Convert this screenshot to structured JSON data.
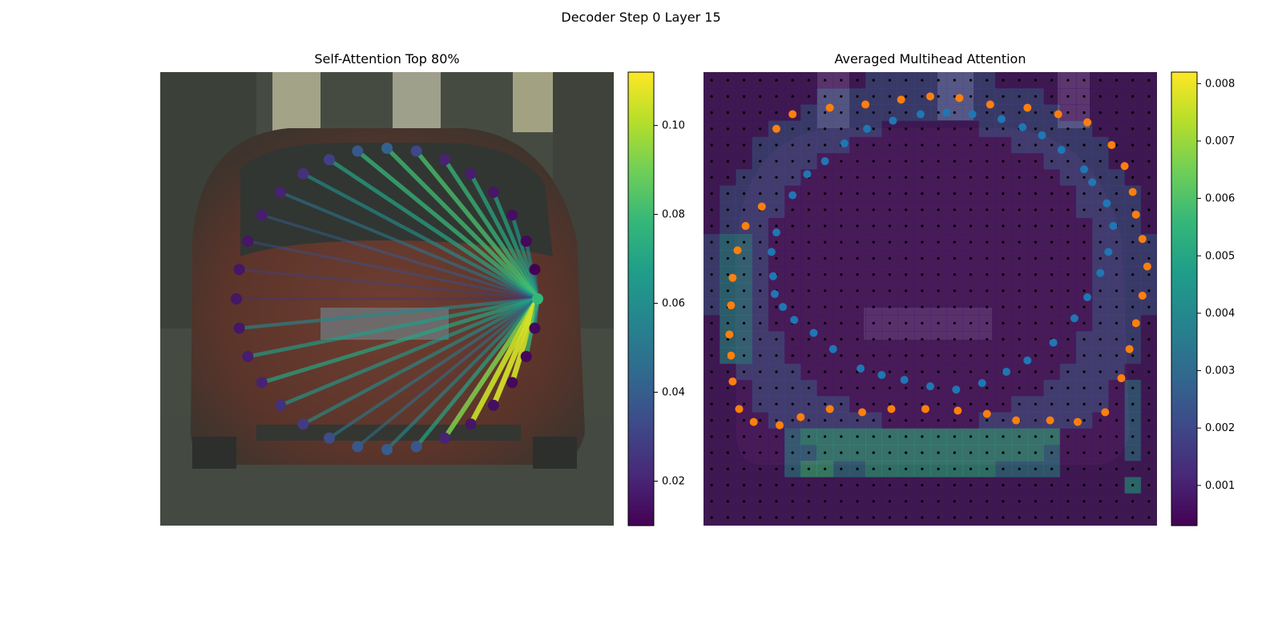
{
  "figure": {
    "suptitle": "Decoder Step 0 Layer 15"
  },
  "chart_data": [
    {
      "type": "network",
      "title": "Self-Attention Top 80%",
      "colormap": "viridis",
      "query_node_index": 0,
      "nodes": [
        {
          "id": 0,
          "x": 1.0,
          "y": 0.0,
          "weight": 0.078
        },
        {
          "id": 1,
          "x": 0.981,
          "y": 0.195,
          "weight": 0.01
        },
        {
          "id": 2,
          "x": 0.924,
          "y": 0.383,
          "weight": 0.012
        },
        {
          "id": 3,
          "x": 0.831,
          "y": 0.556,
          "weight": 0.014
        },
        {
          "id": 4,
          "x": 0.707,
          "y": 0.707,
          "weight": 0.016
        },
        {
          "id": 5,
          "x": 0.556,
          "y": 0.831,
          "weight": 0.018
        },
        {
          "id": 6,
          "x": 0.383,
          "y": 0.924,
          "weight": 0.02
        },
        {
          "id": 7,
          "x": 0.195,
          "y": 0.981,
          "weight": 0.032
        },
        {
          "id": 8,
          "x": 0.0,
          "y": 1.0,
          "weight": 0.042
        },
        {
          "id": 9,
          "x": -0.195,
          "y": 0.981,
          "weight": 0.038
        },
        {
          "id": 10,
          "x": -0.383,
          "y": 0.924,
          "weight": 0.03
        },
        {
          "id": 11,
          "x": -0.556,
          "y": 0.831,
          "weight": 0.024
        },
        {
          "id": 12,
          "x": -0.707,
          "y": 0.707,
          "weight": 0.02
        },
        {
          "id": 13,
          "x": -0.831,
          "y": 0.556,
          "weight": 0.018
        },
        {
          "id": 14,
          "x": -0.924,
          "y": 0.383,
          "weight": 0.016
        },
        {
          "id": 15,
          "x": -0.981,
          "y": 0.195,
          "weight": 0.016
        },
        {
          "id": 16,
          "x": -1.0,
          "y": 0.0,
          "weight": 0.016
        },
        {
          "id": 17,
          "x": -0.981,
          "y": -0.195,
          "weight": 0.016
        },
        {
          "id": 18,
          "x": -0.924,
          "y": -0.383,
          "weight": 0.018
        },
        {
          "id": 19,
          "x": -0.831,
          "y": -0.556,
          "weight": 0.02
        },
        {
          "id": 20,
          "x": -0.707,
          "y": -0.707,
          "weight": 0.024
        },
        {
          "id": 21,
          "x": -0.556,
          "y": -0.831,
          "weight": 0.028
        },
        {
          "id": 22,
          "x": -0.383,
          "y": -0.924,
          "weight": 0.034
        },
        {
          "id": 23,
          "x": -0.195,
          "y": -0.981,
          "weight": 0.038
        },
        {
          "id": 24,
          "x": 0.0,
          "y": -1.0,
          "weight": 0.04
        },
        {
          "id": 25,
          "x": 0.195,
          "y": -0.981,
          "weight": 0.038
        },
        {
          "id": 26,
          "x": 0.383,
          "y": -0.924,
          "weight": 0.02
        },
        {
          "id": 27,
          "x": 0.556,
          "y": -0.831,
          "weight": 0.016
        },
        {
          "id": 28,
          "x": 0.707,
          "y": -0.707,
          "weight": 0.014
        },
        {
          "id": 29,
          "x": 0.831,
          "y": -0.556,
          "weight": 0.012
        },
        {
          "id": 30,
          "x": 0.924,
          "y": -0.383,
          "weight": 0.012
        },
        {
          "id": 31,
          "x": 0.981,
          "y": -0.195,
          "weight": 0.012
        }
      ],
      "edges": [
        {
          "to": 1,
          "weight": 0.045
        },
        {
          "to": 2,
          "weight": 0.06
        },
        {
          "to": 3,
          "weight": 0.065
        },
        {
          "to": 4,
          "weight": 0.07
        },
        {
          "to": 5,
          "weight": 0.072
        },
        {
          "to": 6,
          "weight": 0.078
        },
        {
          "to": 7,
          "weight": 0.082
        },
        {
          "to": 8,
          "weight": 0.08
        },
        {
          "to": 9,
          "weight": 0.078
        },
        {
          "to": 10,
          "weight": 0.07
        },
        {
          "to": 11,
          "weight": 0.06
        },
        {
          "to": 12,
          "weight": 0.05
        },
        {
          "to": 13,
          "weight": 0.04
        },
        {
          "to": 14,
          "weight": 0.035
        },
        {
          "to": 15,
          "weight": 0.03
        },
        {
          "to": 16,
          "weight": 0.025
        },
        {
          "to": 17,
          "weight": 0.058
        },
        {
          "to": 18,
          "weight": 0.066
        },
        {
          "to": 19,
          "weight": 0.07
        },
        {
          "to": 20,
          "weight": 0.064
        },
        {
          "to": 21,
          "weight": 0.06
        },
        {
          "to": 22,
          "weight": 0.052
        },
        {
          "to": 23,
          "weight": 0.048
        },
        {
          "to": 24,
          "weight": 0.058
        },
        {
          "to": 25,
          "weight": 0.07
        },
        {
          "to": 26,
          "weight": 0.092
        },
        {
          "to": 27,
          "weight": 0.104
        },
        {
          "to": 28,
          "weight": 0.106
        },
        {
          "to": 29,
          "weight": 0.105
        },
        {
          "to": 30,
          "weight": 0.078
        },
        {
          "to": 31,
          "weight": 0.062
        }
      ],
      "colorbar": {
        "min": 0.01,
        "max": 0.112,
        "ticks": [
          0.02,
          0.04,
          0.06,
          0.08,
          0.1
        ],
        "tick_labels": [
          "0.02",
          "0.04",
          "0.06",
          "0.08",
          "0.10"
        ]
      }
    },
    {
      "type": "heatmap",
      "title": "Averaged Multihead Attention",
      "colormap": "viridis",
      "grid_size": [
        28,
        28
      ],
      "orange_points_xy_grid": [
        [
          4.5,
          3.5
        ],
        [
          5.5,
          2.6
        ],
        [
          7.8,
          2.2
        ],
        [
          10,
          2
        ],
        [
          12.2,
          1.7
        ],
        [
          14.0,
          1.5
        ],
        [
          15.8,
          1.6
        ],
        [
          17.7,
          2.0
        ],
        [
          20.0,
          2.2
        ],
        [
          21.9,
          2.6
        ],
        [
          23.7,
          3.1
        ],
        [
          25.2,
          4.5
        ],
        [
          26.0,
          5.8
        ],
        [
          26.5,
          7.4
        ],
        [
          26.7,
          8.8
        ],
        [
          27.1,
          10.3
        ],
        [
          27.4,
          12.0
        ],
        [
          27.1,
          13.8
        ],
        [
          26.7,
          15.5
        ],
        [
          26.3,
          17.1
        ],
        [
          25.8,
          18.9
        ],
        [
          24.8,
          21.0
        ],
        [
          23.1,
          21.6
        ],
        [
          21.4,
          21.5
        ],
        [
          19.3,
          21.5
        ],
        [
          17.5,
          21.1
        ],
        [
          15.7,
          20.9
        ],
        [
          13.7,
          20.8
        ],
        [
          11.6,
          20.8
        ],
        [
          9.8,
          21.0
        ],
        [
          7.8,
          20.8
        ],
        [
          6.0,
          21.3
        ],
        [
          4.7,
          21.8
        ],
        [
          3.1,
          21.6
        ],
        [
          2.2,
          20.8
        ],
        [
          1.8,
          19.1
        ],
        [
          1.7,
          17.5
        ],
        [
          1.6,
          16.2
        ],
        [
          1.7,
          14.4
        ],
        [
          1.8,
          12.7
        ],
        [
          2.1,
          11.0
        ],
        [
          2.6,
          9.5
        ],
        [
          3.6,
          8.3
        ]
      ],
      "blue_points_xy_grid": [
        [
          5.5,
          7.6
        ],
        [
          6.4,
          6.3
        ],
        [
          7.5,
          5.5
        ],
        [
          8.7,
          4.4
        ],
        [
          10.1,
          3.5
        ],
        [
          11.7,
          3.0
        ],
        [
          13.4,
          2.6
        ],
        [
          15.0,
          2.5
        ],
        [
          16.6,
          2.6
        ],
        [
          18.4,
          2.9
        ],
        [
          19.7,
          3.4
        ],
        [
          20.9,
          3.9
        ],
        [
          22.1,
          4.8
        ],
        [
          23.5,
          6.0
        ],
        [
          24.0,
          6.8
        ],
        [
          24.9,
          8.1
        ],
        [
          25.3,
          9.5
        ],
        [
          25.0,
          11.1
        ],
        [
          24.5,
          12.4
        ],
        [
          23.7,
          13.9
        ],
        [
          22.9,
          15.2
        ],
        [
          21.6,
          16.7
        ],
        [
          20.0,
          17.8
        ],
        [
          18.7,
          18.5
        ],
        [
          17.2,
          19.2
        ],
        [
          15.6,
          19.6
        ],
        [
          14.0,
          19.4
        ],
        [
          12.4,
          19.0
        ],
        [
          11.0,
          18.7
        ],
        [
          9.7,
          18.3
        ],
        [
          8.0,
          17.1
        ],
        [
          6.8,
          16.1
        ],
        [
          5.6,
          15.3
        ],
        [
          4.9,
          14.5
        ],
        [
          4.4,
          13.7
        ],
        [
          4.3,
          12.6
        ],
        [
          4.2,
          11.1
        ],
        [
          4.5,
          9.9
        ]
      ],
      "colorbar": {
        "min": 0.0003,
        "max": 0.0082,
        "ticks": [
          0.001,
          0.002,
          0.003,
          0.004,
          0.005,
          0.006,
          0.007,
          0.008
        ],
        "tick_labels": [
          "0.001",
          "0.002",
          "0.003",
          "0.004",
          "0.005",
          "0.006",
          "0.007",
          "0.008"
        ]
      }
    }
  ],
  "colors": {
    "viridis": [
      "#440154",
      "#482878",
      "#3e4989",
      "#31688e",
      "#26828e",
      "#1f9e89",
      "#35b779",
      "#6ece58",
      "#b5de2b",
      "#fde725"
    ],
    "orange": "#ff7f0e",
    "blue": "#1f77b4"
  },
  "icons": {
    "background": "photo-of-car-rear"
  }
}
